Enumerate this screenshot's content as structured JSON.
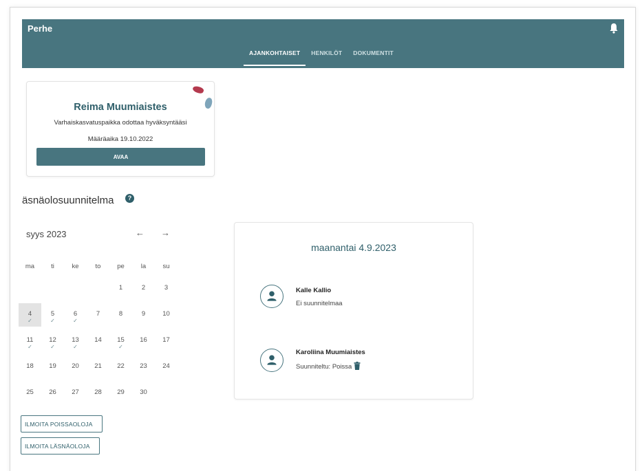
{
  "header": {
    "brand": "Perhe",
    "tabs": [
      {
        "label": "AJANKOHTAISET",
        "active": true
      },
      {
        "label": "HENKILÖT",
        "active": false
      },
      {
        "label": "DOKUMENTIT",
        "active": false
      }
    ]
  },
  "notice_card": {
    "name": "Reima Muumiaistes",
    "subtitle": "Varhaiskasvatuspaikka odottaa hyväksyntääsi",
    "deadline": "Määräaika 19.10.2022",
    "button": "AVAA"
  },
  "section": {
    "title": "äsnäolosuunnitelma"
  },
  "calendar": {
    "month": "syys 2023",
    "prev": "←",
    "next": "→",
    "weekdays": [
      "ma",
      "ti",
      "ke",
      "to",
      "pe",
      "la",
      "su"
    ],
    "weeks": [
      [
        "",
        "",
        "",
        "",
        "1",
        "2",
        "3"
      ],
      [
        "4",
        "5",
        "6",
        "7",
        "8",
        "9",
        "10"
      ],
      [
        "11",
        "12",
        "13",
        "14",
        "15",
        "16",
        "17"
      ],
      [
        "18",
        "19",
        "20",
        "21",
        "22",
        "23",
        "24"
      ],
      [
        "25",
        "26",
        "27",
        "28",
        "29",
        "30",
        ""
      ]
    ],
    "checked_days": [
      "4",
      "5",
      "6",
      "11",
      "12",
      "13",
      "15"
    ],
    "selected_day": "4"
  },
  "actions": {
    "report_absence": "ILMOITA POISSAOLOJA",
    "report_presence": "ILMOITA LÄSNÄOLOJA"
  },
  "day_panel": {
    "title": "maanantai 4.9.2023",
    "people": [
      {
        "name": "Kalle Kallio",
        "status": "Ei suunnitelmaa",
        "deletable": false
      },
      {
        "name": "Karoliina Muumiaistes",
        "status": "Suunniteltu: Poissa",
        "deletable": true
      }
    ]
  },
  "colors": {
    "primary": "#48757f",
    "heading": "#2f5f6a",
    "accent_red": "#b43a4e",
    "accent_blue": "#7fa5ba"
  }
}
